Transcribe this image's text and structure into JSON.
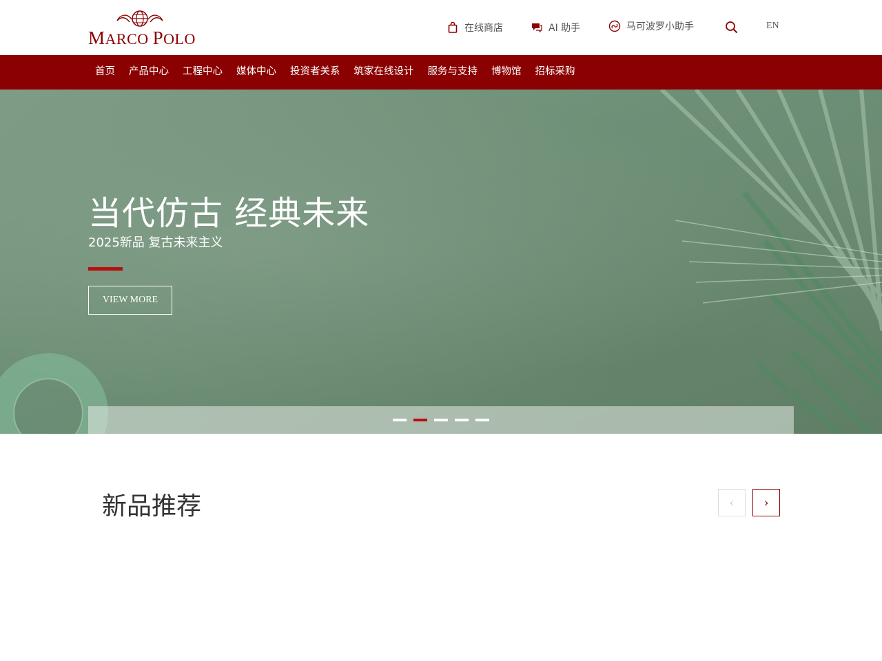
{
  "brand": {
    "logo_text": "MARCO POLO",
    "color": "#8b0000"
  },
  "header": {
    "utilities": [
      {
        "label": "在线商店",
        "icon": "shopping-bag-icon"
      },
      {
        "label": "AI 助手",
        "icon": "chat-bubble-icon"
      },
      {
        "label": "马可波罗小助手",
        "icon": "mini-program-icon"
      }
    ],
    "search_icon": "search-icon",
    "language": "EN"
  },
  "nav": {
    "items": [
      "首页",
      "产品中心",
      "工程中心",
      "媒体中心",
      "投资者关系",
      "筑家在线设计",
      "服务与支持",
      "博物馆",
      "招标采购"
    ]
  },
  "hero": {
    "title": "当代仿古 经典未来",
    "subtitle": "2025新品 复古未来主义",
    "button": "VIEW MORE",
    "slides_count": 5,
    "active_slide": 2
  },
  "products": {
    "title": "新品推荐",
    "prev_icon": "chevron-left-icon",
    "next_icon": "chevron-right-icon"
  },
  "colors": {
    "accent": "#8b0000",
    "indicator_active": "#b80f0f",
    "hero_bg": "#6e8f77"
  }
}
